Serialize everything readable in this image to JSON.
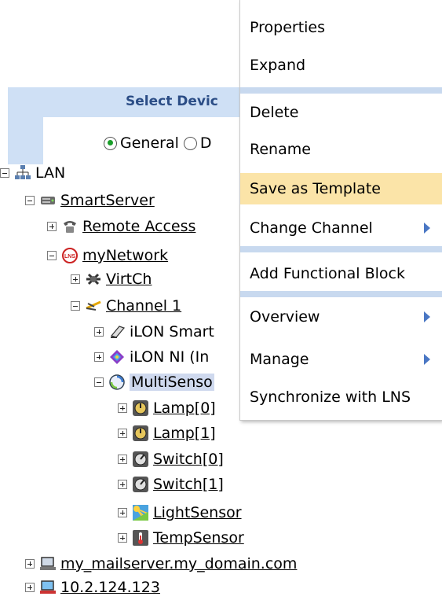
{
  "panel": {
    "title": "Select Devic",
    "radio": [
      {
        "label": "General",
        "checked": true
      },
      {
        "label": "D",
        "checked": false
      }
    ]
  },
  "tree": {
    "lan": "LAN",
    "smartserver": "SmartServer",
    "remote_access": "Remote Access",
    "mynetwork": "myNetwork",
    "virtch": "VirtCh",
    "channel1": "Channel 1",
    "ilon_smart": "iLON Smart",
    "ilon_ni": "iLON NI (In",
    "multisensor": "MultiSenso",
    "lamp0": "Lamp[0]",
    "lamp1": "Lamp[1]",
    "switch0": "Switch[0]",
    "switch1": "Switch[1]",
    "lightsensor": "LightSensor",
    "tempsensor": "TempSensor",
    "mailserver": "my_mailserver.my_domain.com",
    "ip": "10.2.124.123"
  },
  "menu": {
    "properties": "Properties",
    "expand": "Expand",
    "delete": "Delete",
    "rename": "Rename",
    "save_as_template": "Save as Template",
    "change_channel": "Change Channel",
    "add_functional_block": "Add Functional Block",
    "overview": "Overview",
    "manage": "Manage",
    "synchronize": "Synchronize with LNS"
  },
  "colors": {
    "menu_highlight": "#fbe4a8",
    "menu_separator": "#c8d9ef",
    "submenu_arrow": "#4a77c4",
    "panel_header": "#cfe0f5"
  }
}
